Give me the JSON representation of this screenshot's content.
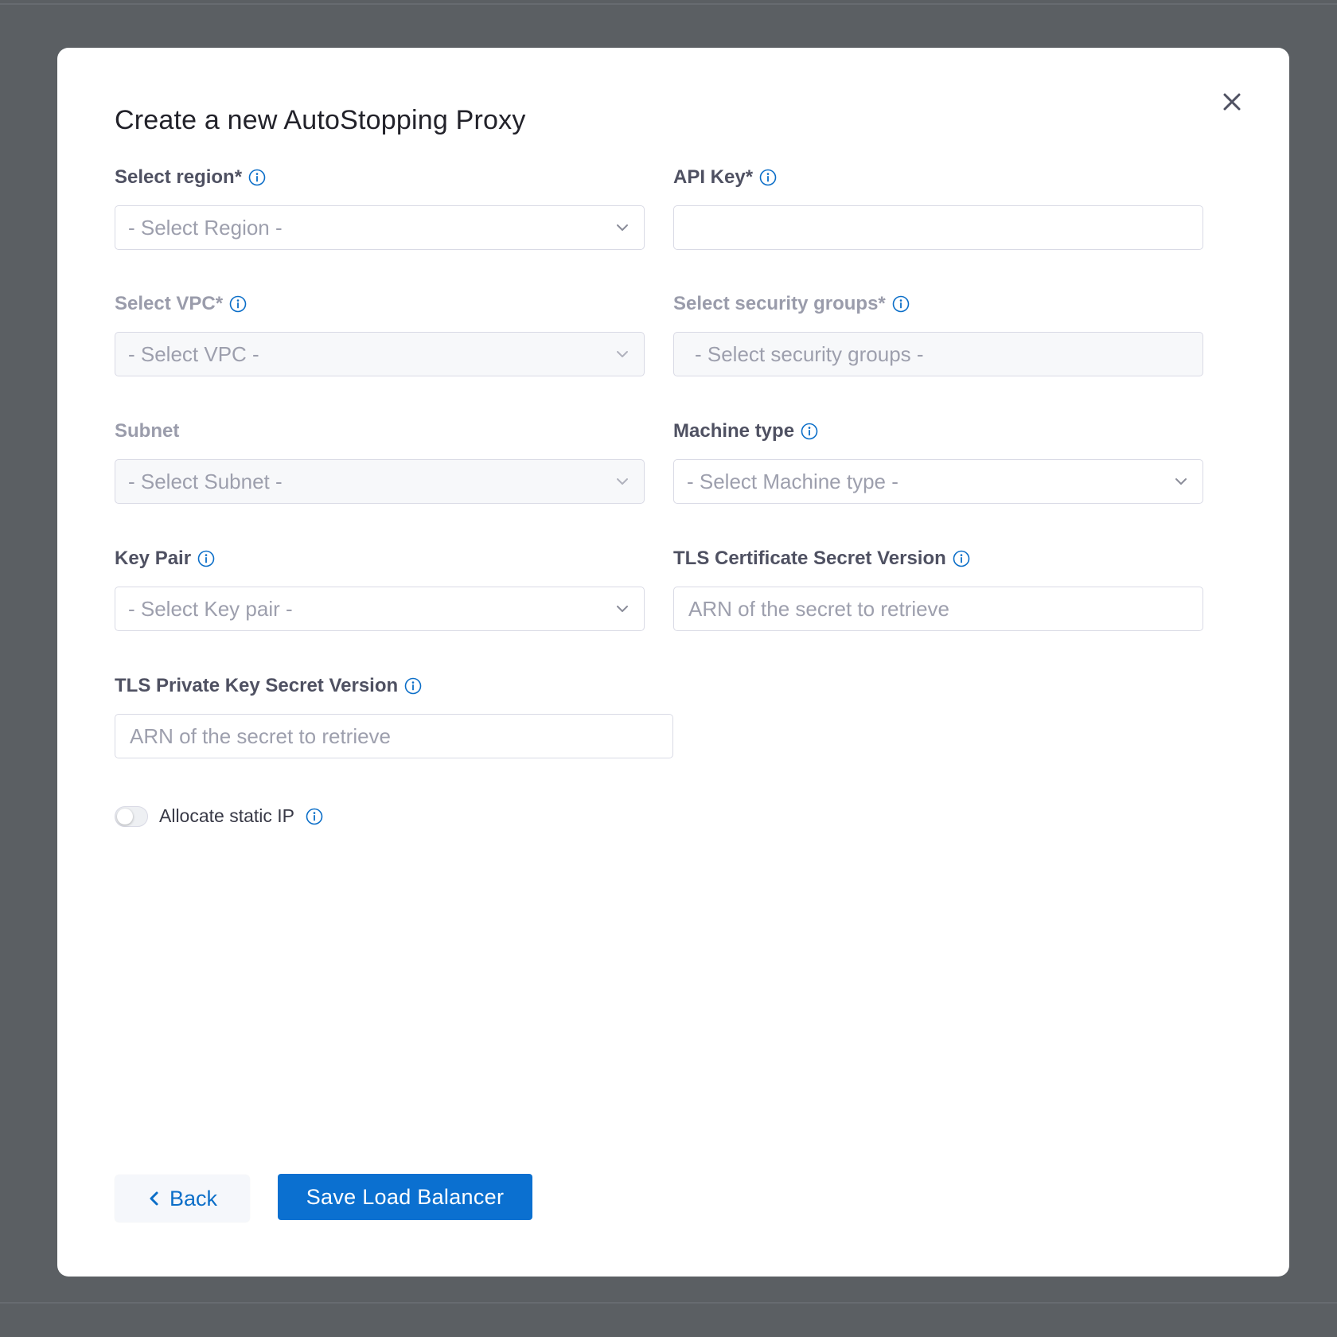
{
  "dialog": {
    "title": "Create a new AutoStopping Proxy",
    "close_icon": "close-icon"
  },
  "fields": {
    "region": {
      "label": "Select region*",
      "placeholder": "- Select Region -"
    },
    "api_key": {
      "label": "API Key*",
      "value": ""
    },
    "vpc": {
      "label": "Select VPC*",
      "placeholder": "- Select VPC -"
    },
    "security_groups": {
      "label": "Select security groups*",
      "placeholder": "- Select security groups -"
    },
    "subnet": {
      "label": "Subnet",
      "placeholder": "- Select Subnet -"
    },
    "machine_type": {
      "label": "Machine type",
      "placeholder": "- Select Machine type -"
    },
    "key_pair": {
      "label": "Key Pair",
      "placeholder": "- Select Key pair -"
    },
    "tls_cert": {
      "label": "TLS Certificate Secret Version",
      "placeholder": "ARN of the secret to retrieve"
    },
    "tls_private_key": {
      "label": "TLS Private Key Secret Version",
      "placeholder": "ARN of the secret to retrieve"
    }
  },
  "static_ip": {
    "label": "Allocate static IP",
    "enabled": false
  },
  "footer": {
    "back_label": "Back",
    "save_label": "Save Load Balancer"
  },
  "colors": {
    "accent": "#0b70d0",
    "overlay": "#5b5f63",
    "info_icon": "#0b6ec8"
  }
}
